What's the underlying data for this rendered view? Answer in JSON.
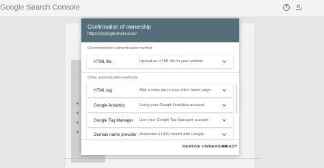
{
  "app": {
    "title_prefix": "Google",
    "title_suffix": " Search Console",
    "help_icon": "help-circle-icon",
    "users_icon": "manage-users-icon"
  },
  "dialog": {
    "title": "Confirmation of ownership",
    "subtitle": "https://testsgdomain.com/",
    "header_color": "#546e7a",
    "recommended_label": "Recommended authentication method",
    "other_label": "Other authentication methods",
    "recommended": [
      {
        "name": "HTML file",
        "description": "Upload an HTML file to your website"
      }
    ],
    "others": [
      {
        "name": "HTML tag",
        "description": "Add a meta tag to your site's home page"
      },
      {
        "name": "Google Analytics",
        "description": "Using your Google Analytics account"
      },
      {
        "name": "Google Tag Manager",
        "description": "Use your Google Tag Manager account"
      },
      {
        "name": "Domain name provider",
        "description": "Associate a DNS record with Google"
      }
    ],
    "remove_label": "REMOVE OWNERSHIP",
    "ready_label": "READY"
  }
}
